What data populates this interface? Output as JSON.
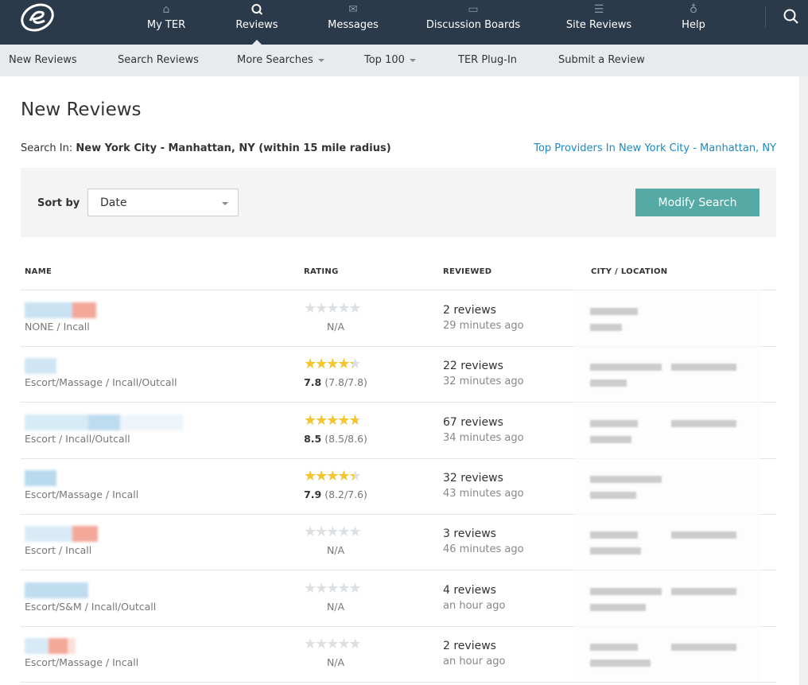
{
  "topnav": {
    "items": [
      {
        "label": "My TER",
        "icon": "home-icon"
      },
      {
        "label": "Reviews",
        "icon": "search-icon",
        "active": true
      },
      {
        "label": "Messages",
        "icon": "envelope-icon"
      },
      {
        "label": "Discussion Boards",
        "icon": "speech-bubble-icon"
      },
      {
        "label": "Site Reviews",
        "icon": "document-icon"
      },
      {
        "label": "Help",
        "icon": "lightbulb-icon"
      }
    ]
  },
  "subnav": [
    "New Reviews",
    "Search Reviews",
    "More Searches",
    "Top 100",
    "TER Plug-In",
    "Submit a Review"
  ],
  "page": {
    "title": "New Reviews",
    "search_in_label": "Search In:",
    "search_in_value": "New York City - Manhattan, NY (within 15 mile radius)",
    "top_link": "Top Providers In New York City - Manhattan, NY"
  },
  "filter": {
    "sort_label": "Sort by",
    "sort_value": "Date",
    "modify": "Modify Search"
  },
  "table": {
    "headers": [
      "NAME",
      "RATING",
      "REVIEWED",
      "CITY / LOCATION"
    ],
    "rows": [
      {
        "type": "NONE / Incall",
        "stars": 0,
        "score": "",
        "detail": "",
        "na": "N/A",
        "reviews": "2 reviews",
        "time": "29 minutes ago"
      },
      {
        "type": "Escort/Massage / Incall/Outcall",
        "stars": 0.78,
        "score": "7.8",
        "detail": " (7.8/7.8)",
        "na": "",
        "reviews": "22 reviews",
        "time": "32 minutes ago"
      },
      {
        "type": "Escort / Incall/Outcall",
        "stars": 0.85,
        "score": "8.5",
        "detail": " (8.5/8.6)",
        "na": "",
        "reviews": "67 reviews",
        "time": "34 minutes ago"
      },
      {
        "type": "Escort/Massage / Incall",
        "stars": 0.79,
        "score": "7.9",
        "detail": " (8.2/7.6)",
        "na": "",
        "reviews": "32 reviews",
        "time": "43 minutes ago"
      },
      {
        "type": "Escort / Incall",
        "stars": 0,
        "score": "",
        "detail": "",
        "na": "N/A",
        "reviews": "3 reviews",
        "time": "46 minutes ago"
      },
      {
        "type": "Escort/S&M / Incall/Outcall",
        "stars": 0,
        "score": "",
        "detail": "",
        "na": "N/A",
        "reviews": "4 reviews",
        "time": "an hour ago"
      },
      {
        "type": "Escort/Massage / Incall",
        "stars": 0,
        "score": "",
        "detail": "",
        "na": "N/A",
        "reviews": "2 reviews",
        "time": "an hour ago"
      }
    ]
  },
  "colors": {
    "nav_bg": "#2b3a4b",
    "accent": "#55aaa5",
    "link": "#1a8bc4",
    "star": "#f5c62c"
  }
}
